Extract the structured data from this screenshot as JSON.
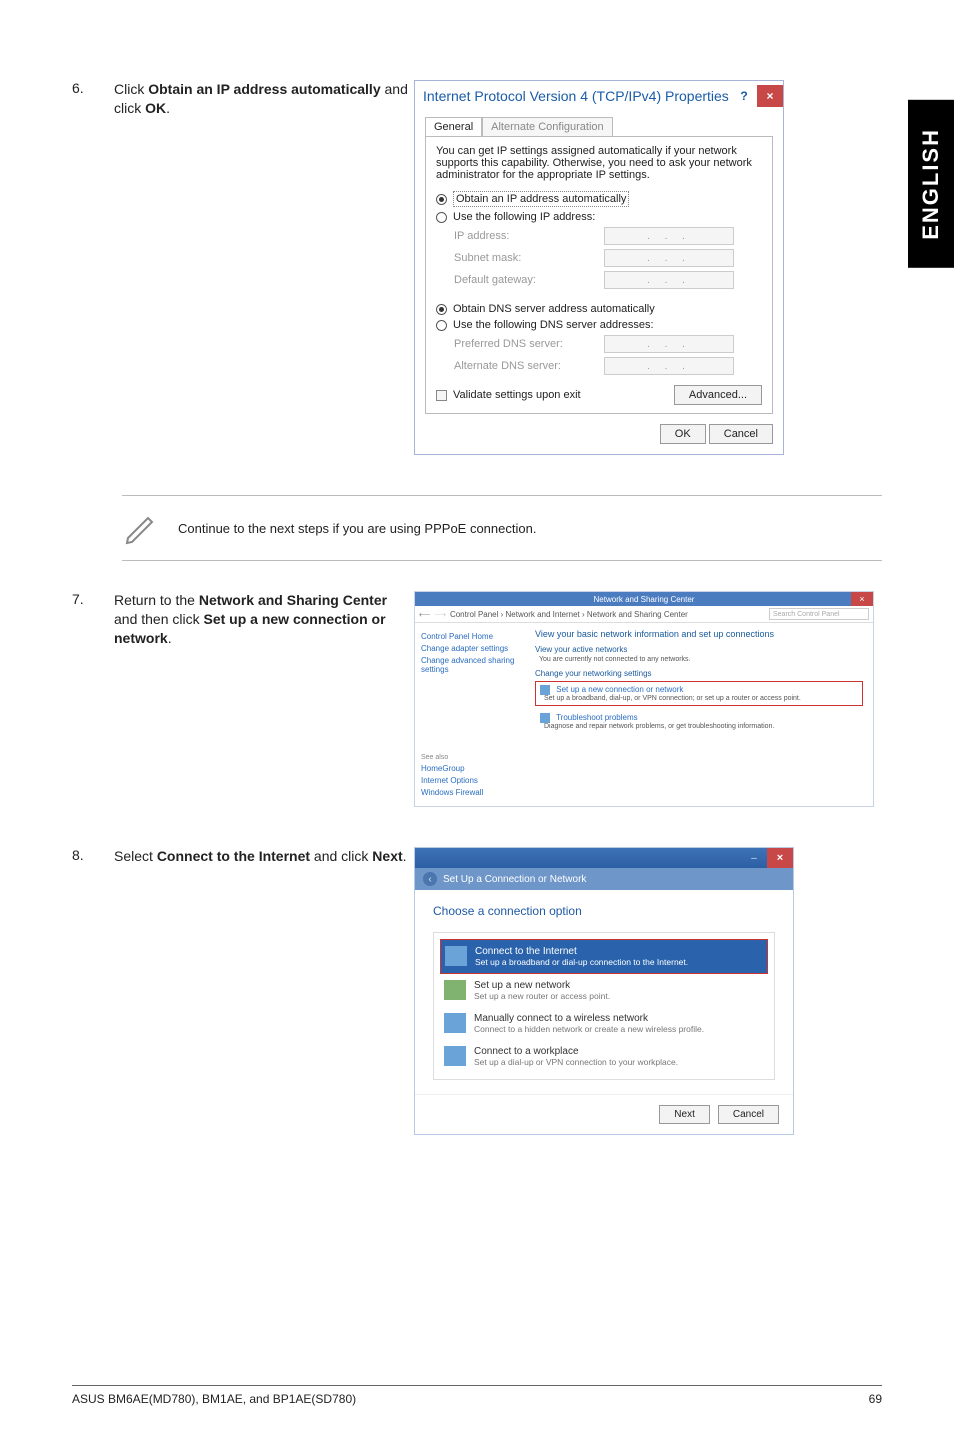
{
  "sidebar_label": "ENGLISH",
  "step6": {
    "num": "6.",
    "text_prefix": "Click ",
    "bold1": "Obtain an IP address automatically",
    "text_mid": " and click ",
    "bold2": "OK",
    "text_suffix": "."
  },
  "ipv4_dialog": {
    "title": "Internet Protocol Version 4 (TCP/IPv4) Properties",
    "help": "?",
    "close": "×",
    "tab_general": "General",
    "tab_alt": "Alternate Configuration",
    "infotext": "You can get IP settings assigned automatically if your network supports this capability. Otherwise, you need to ask your network administrator for the appropriate IP settings.",
    "r_obtain_ip": "Obtain an IP address automatically",
    "r_use_ip": "Use the following IP address:",
    "lbl_ip": "IP address:",
    "lbl_subnet": "Subnet mask:",
    "lbl_gateway": "Default gateway:",
    "r_obtain_dns": "Obtain DNS server address automatically",
    "r_use_dns": "Use the following DNS server addresses:",
    "lbl_pref_dns": "Preferred DNS server:",
    "lbl_alt_dns": "Alternate DNS server:",
    "chk_validate": "Validate settings upon exit",
    "btn_adv": "Advanced...",
    "btn_ok": "OK",
    "btn_cancel": "Cancel",
    "ip_dots": ".   .   ."
  },
  "note_text": "Continue to the next steps if you are using PPPoE connection.",
  "step7": {
    "num": "7.",
    "text_prefix": "Return to the ",
    "bold1": "Network and Sharing Center",
    "text_mid": " and then click ",
    "bold2": "Set up a new connection or network",
    "text_suffix": "."
  },
  "cpl": {
    "window_title": "Network and Sharing Center",
    "close": "×",
    "crumbs": "Control Panel › Network and Internet › Network and Sharing Center",
    "search_placeholder": "Search Control Panel",
    "side_home": "Control Panel Home",
    "side_adapter": "Change adapter settings",
    "side_advshare": "Change advanced sharing settings",
    "side_seealso": "See also",
    "side_homegroup": "HomeGroup",
    "side_iopts": "Internet Options",
    "side_firewall": "Windows Firewall",
    "main_h": "View your basic network information and set up connections",
    "main_viewactive": "View your active networks",
    "main_notconn": "You are currently not connected to any networks.",
    "main_changenet": "Change your networking settings",
    "opt_setup_t": "Set up a new connection or network",
    "opt_setup_d": "Set up a broadband, dial-up, or VPN connection; or set up a router or access point.",
    "opt_trouble_t": "Troubleshoot problems",
    "opt_trouble_d": "Diagnose and repair network problems, or get troubleshooting information."
  },
  "step8": {
    "num": "8.",
    "text_prefix": "Select ",
    "bold1": "Connect to the Internet",
    "text_mid": " and click ",
    "bold2": "Next",
    "text_suffix": "."
  },
  "wiz": {
    "close": "×",
    "back": "‹",
    "subtitle": "Set Up a Connection or Network",
    "h2": "Choose a connection option",
    "opt1_t": "Connect to the Internet",
    "opt1_d": "Set up a broadband or dial-up connection to the Internet.",
    "opt2_t": "Set up a new network",
    "opt2_d": "Set up a new router or access point.",
    "opt3_t": "Manually connect to a wireless network",
    "opt3_d": "Connect to a hidden network or create a new wireless profile.",
    "opt4_t": "Connect to a workplace",
    "opt4_d": "Set up a dial-up or VPN connection to your workplace.",
    "btn_next": "Next",
    "btn_cancel": "Cancel"
  },
  "footer_left": "ASUS BM6AE(MD780), BM1AE, and BP1AE(SD780)",
  "footer_right": "69"
}
